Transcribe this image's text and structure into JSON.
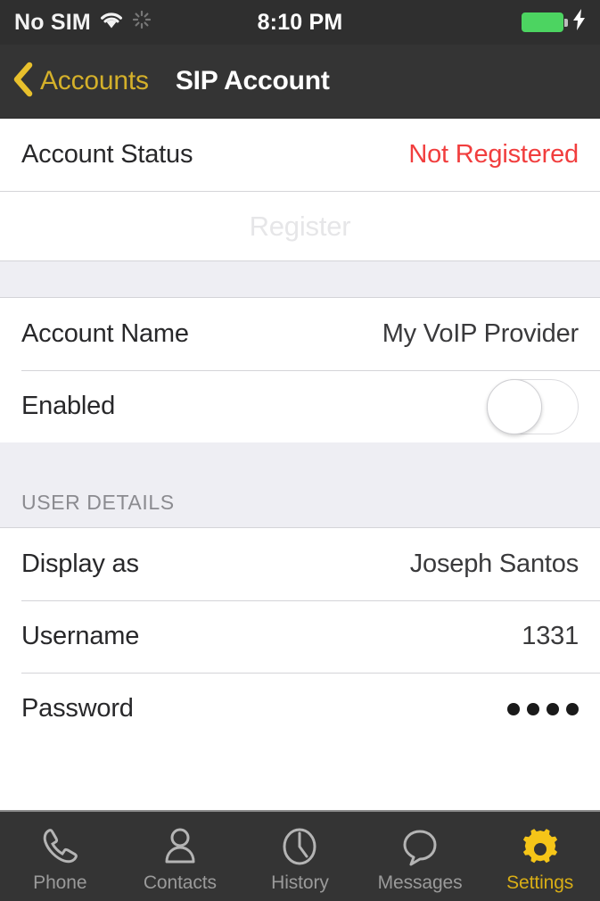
{
  "status_bar": {
    "carrier": "No SIM",
    "wifi_icon": "wifi-icon",
    "activity_icon": "activity-indicator-icon",
    "time": "8:10 PM",
    "battery_icon": "battery-full-icon",
    "charging_icon": "lightning-bolt-icon",
    "battery_color": "#4cd461"
  },
  "nav_bar": {
    "back_icon": "chevron-left-icon",
    "back_label": "Accounts",
    "title": "SIP Account",
    "tint_color": "#d4b02a",
    "background_color": "#343434"
  },
  "sections": {
    "status_section": {
      "rows": [
        {
          "label": "Account Status",
          "value": "Not Registered",
          "value_color": "#f13e3e"
        }
      ],
      "register_button": {
        "label": "Register",
        "enabled": false
      }
    },
    "account_section": {
      "rows": [
        {
          "label": "Account Name",
          "value": "My VoIP Provider"
        },
        {
          "label": "Enabled",
          "toggle_on": false
        }
      ]
    },
    "user_details_section": {
      "header": "USER DETAILS",
      "rows": [
        {
          "label": "Display as",
          "value": "Joseph Santos"
        },
        {
          "label": "Username",
          "value": "1331"
        },
        {
          "label": "Password",
          "value": "●●●●",
          "dots": 4
        }
      ]
    }
  },
  "tab_bar": {
    "active_color": "#d9ae16",
    "inactive_color": "#9a9a9a",
    "items": [
      {
        "label": "Phone",
        "icon": "phone-handset-icon",
        "active": false
      },
      {
        "label": "Contacts",
        "icon": "person-icon",
        "active": false
      },
      {
        "label": "History",
        "icon": "clock-icon",
        "active": false
      },
      {
        "label": "Messages",
        "icon": "speech-bubble-icon",
        "active": false
      },
      {
        "label": "Settings",
        "icon": "gear-icon",
        "active": true
      }
    ]
  }
}
